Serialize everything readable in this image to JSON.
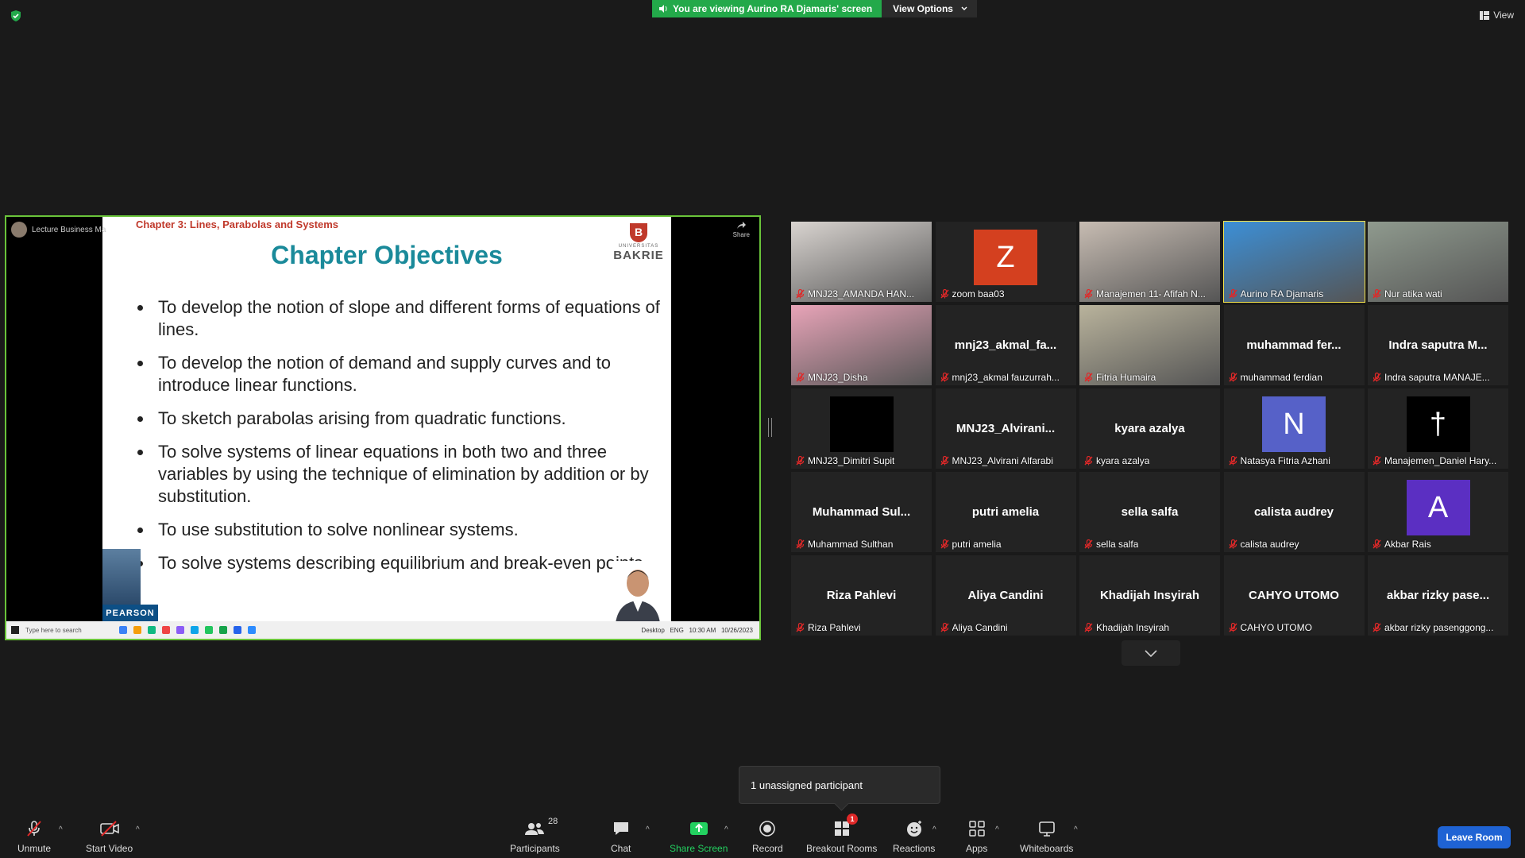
{
  "banner": {
    "viewing_text": "You are viewing Aurino RA Djamaris' screen",
    "view_options": "View Options"
  },
  "view_button": "View",
  "shared_screen": {
    "presenter": "Lecture Business Ma",
    "share_label": "Share",
    "slide": {
      "chapter": "Chapter 3: Lines, Parabolas and Systems",
      "title": "Chapter Objectives",
      "logo_small": "UNIVERSITAS",
      "logo_name": "BAKRIE",
      "publisher": "PEARSON",
      "bullets": [
        "To develop the notion of slope and different forms of equations of lines.",
        "To develop the notion of demand and supply curves and to introduce linear functions.",
        "To sketch parabolas arising from quadratic functions.",
        "To solve systems of linear equations in both two and three variables by using the technique of elimination by addition or by substitution.",
        "To use substitution to solve nonlinear systems.",
        "To solve systems describing equilibrium and break-even points."
      ]
    },
    "taskbar": {
      "search_placeholder": "Type here to search",
      "desktop": "Desktop",
      "lang": "ENG",
      "time": "10:30 AM",
      "date": "10/26/2023"
    }
  },
  "participants": [
    {
      "label": "MNJ23_AMANDA HAN...",
      "type": "photo",
      "color": "#d9d4d0"
    },
    {
      "label": "zoom baa03",
      "type": "letter",
      "letter": "Z",
      "color": "#d4401f"
    },
    {
      "label": "Manajemen 11- Afifah N...",
      "type": "photo",
      "color": "#c7bcb2"
    },
    {
      "label": "Aurino RA Djamaris",
      "type": "photo",
      "color": "#3c8fd6",
      "active": true
    },
    {
      "label": "Nur atika wati",
      "type": "photo",
      "color": "#8f9a8e"
    },
    {
      "label": "MNJ23_Disha",
      "type": "photo",
      "color": "#e8a4b8"
    },
    {
      "label": "mnj23_akmal fauzurrah...",
      "center": "mnj23_akmal_fa...",
      "type": "name"
    },
    {
      "label": "Fitria Humaira",
      "type": "photo",
      "color": "#b9b39c"
    },
    {
      "label": "muhammad ferdian",
      "center": "muhammad fer...",
      "type": "name"
    },
    {
      "label": "Indra saputra MANAJE...",
      "center": "Indra saputra M...",
      "type": "name"
    },
    {
      "label": "MNJ23_Dimitri Supit",
      "type": "black"
    },
    {
      "label": "MNJ23_Alvirani Alfarabi",
      "center": "MNJ23_Alvirani...",
      "type": "name"
    },
    {
      "label": "kyara azalya",
      "center": "kyara azalya",
      "type": "name"
    },
    {
      "label": "Natasya Fitria Azhani",
      "type": "letter",
      "letter": "N",
      "color": "#5661c8"
    },
    {
      "label": "Manajemen_Daniel Hary...",
      "type": "letter",
      "letter": "†",
      "color": "#000000"
    },
    {
      "label": "Muhammad Sulthan",
      "center": "Muhammad Sul...",
      "type": "name"
    },
    {
      "label": "putri amelia",
      "center": "putri amelia",
      "type": "name"
    },
    {
      "label": "sella salfa",
      "center": "sella salfa",
      "type": "name"
    },
    {
      "label": "calista audrey",
      "center": "calista audrey",
      "type": "name"
    },
    {
      "label": "Akbar Rais",
      "type": "letter",
      "letter": "A",
      "color": "#5b2fc2"
    },
    {
      "label": "Riza Pahlevi",
      "center": "Riza Pahlevi",
      "type": "name"
    },
    {
      "label": "Aliya Candini",
      "center": "Aliya Candini",
      "type": "name"
    },
    {
      "label": "Khadijah Insyirah",
      "center": "Khadijah Insyirah",
      "type": "name"
    },
    {
      "label": "CAHYO UTOMO",
      "center": "CAHYO UTOMO",
      "type": "name"
    },
    {
      "label": "akbar rizky pasenggong...",
      "center": "akbar rizky pase...",
      "type": "name"
    }
  ],
  "popover": "1 unassigned participant",
  "toolbar": {
    "unmute": "Unmute",
    "start_video": "Start Video",
    "participants": "Participants",
    "participants_count": "28",
    "chat": "Chat",
    "share_screen": "Share Screen",
    "record": "Record",
    "breakout_rooms": "Breakout Rooms",
    "breakout_badge": "1",
    "reactions": "Reactions",
    "apps": "Apps",
    "whiteboards": "Whiteboards",
    "leave_room": "Leave Room"
  },
  "colors": {
    "accent_green": "#23a94a",
    "active_speaker": "#f4e34b",
    "leave_blue": "#1f63d4",
    "muted_red": "#e02828"
  }
}
